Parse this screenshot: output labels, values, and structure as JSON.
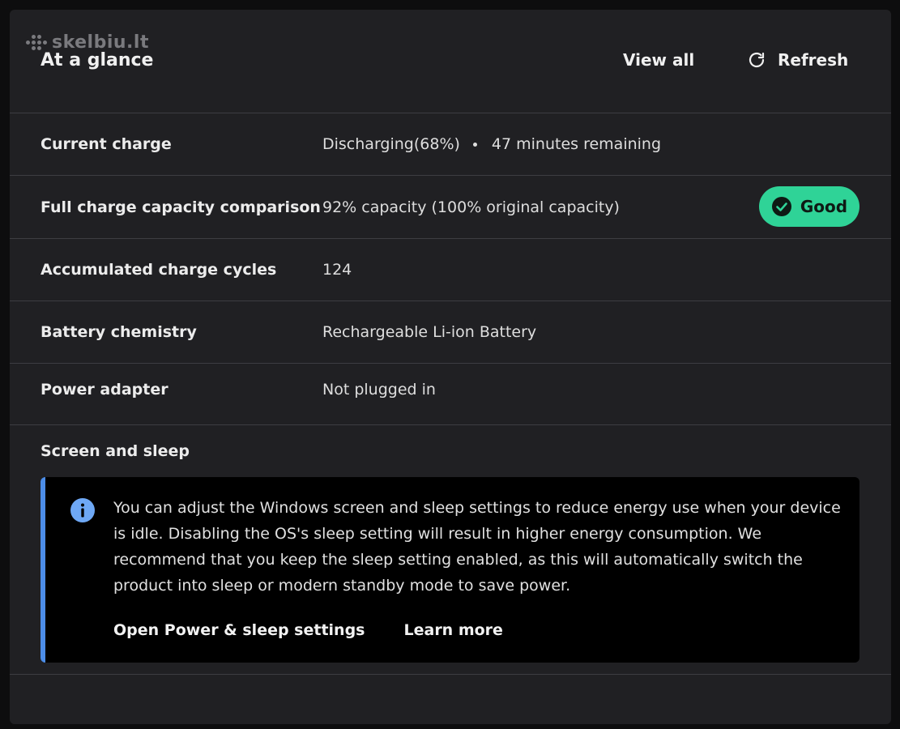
{
  "watermark": {
    "text": "skelbiu.lt"
  },
  "header": {
    "title": "At a glance",
    "view_all_label": "View all",
    "refresh_label": "Refresh",
    "refresh_icon": "refresh-icon"
  },
  "rows": [
    {
      "label": "Current charge",
      "value": "Discharging(68%)",
      "extra": "47 minutes remaining"
    },
    {
      "label": "Full charge capacity comparison",
      "value": "92% capacity (100% original capacity)",
      "badge": {
        "label": "Good",
        "icon": "check-circle-icon",
        "color": "#2fd397"
      }
    },
    {
      "label": "Accumulated charge cycles",
      "value": "124"
    },
    {
      "label": "Battery chemistry",
      "value": "Rechargeable Li-ion Battery"
    },
    {
      "label": "Power adapter",
      "value": "Not plugged in"
    }
  ],
  "screen_sleep": {
    "title": "Screen and sleep",
    "info_icon": "info-icon",
    "accent_color": "#4c8de8",
    "message": "You can adjust the Windows screen and sleep settings to reduce energy use when your device is idle. Disabling the OS's sleep setting will result in higher energy consumption. We recommend that you keep the sleep setting enabled, as this will automatically switch the product into sleep or modern standby mode to save power.",
    "open_settings_label": "Open Power & sleep settings",
    "learn_more_label": "Learn more"
  }
}
